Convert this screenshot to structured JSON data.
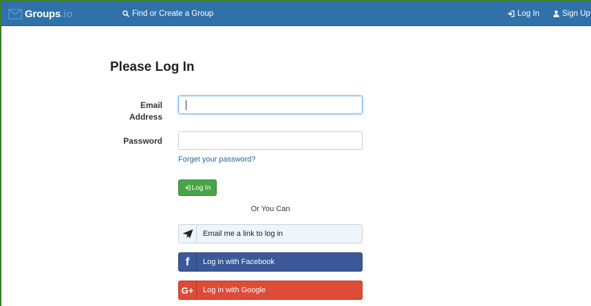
{
  "navbar": {
    "brand": "Groups",
    "brand_suffix": ".io",
    "find_label": "Find or Create a Group",
    "login_label": "Log In",
    "signup_label": "Sign Up"
  },
  "main": {
    "title": "Please Log In",
    "email_label": "Email Address",
    "email_value": "",
    "password_label": "Password",
    "password_value": "",
    "forgot_label": "Forget your password?",
    "login_button": "Log In",
    "or_text": "Or You Can",
    "email_link_button": "Email me a link to log in",
    "facebook_button": "Log in with Facebook",
    "google_button": "Log in with Google"
  },
  "icons": {
    "brand": "envelope-icon",
    "find": "search-icon",
    "login": "sign-in-icon",
    "signup": "user-icon",
    "email_link": "paper-plane-icon",
    "facebook": "facebook-icon",
    "google": "google-plus-icon"
  },
  "colors": {
    "navbar": "#3071a9",
    "link": "#2a6496",
    "login_button": "#47a447",
    "email_button": "#eef5fb",
    "facebook": "#3b5998",
    "google": "#dd4b39"
  }
}
